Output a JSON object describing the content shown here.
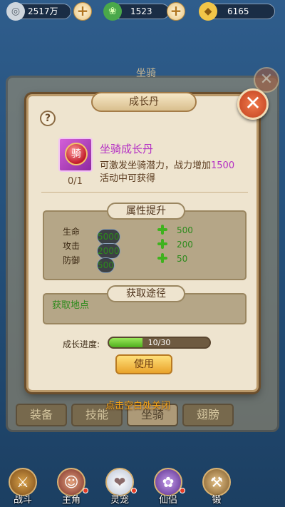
{
  "currency": {
    "silver": {
      "icon": "silver-coin-icon",
      "value": "2517万"
    },
    "jade": {
      "icon": "jade-icon",
      "value": "1523"
    },
    "gold": {
      "icon": "gold-ingot-icon",
      "value": "6165"
    }
  },
  "background_panel": {
    "title": "坐骑",
    "tabs": [
      "装备",
      "技能",
      "坐骑",
      "翅膀"
    ],
    "selected_tab": "坐骑"
  },
  "dialog": {
    "title": "成长丹",
    "help_label": "?",
    "close_label": "✕",
    "item": {
      "icon_char": "骑",
      "count": "0/1",
      "name": "坐骑成长丹",
      "desc_prefix": "可激发坐骑潜力，战力增加",
      "desc_highlight": "1500",
      "desc_line2": "活动中可获得"
    },
    "attributes": {
      "header": "属性提升",
      "rows": [
        {
          "name": "生命",
          "current": "5000",
          "add": "500"
        },
        {
          "name": "攻击",
          "current": "2000",
          "add": "200"
        },
        {
          "name": "防御",
          "current": "500",
          "add": "50"
        }
      ]
    },
    "source": {
      "header": "获取途径",
      "link": "获取地点"
    },
    "progress": {
      "label": "成长进度:",
      "text": "10/30",
      "fraction": 0.333
    },
    "use_button": "使用"
  },
  "hint": "点击空白处关闭",
  "bottom_nav": [
    {
      "label": "战斗",
      "icon": "crossed-swords-icon",
      "badge": false
    },
    {
      "label": "主角",
      "icon": "hero-avatar-icon",
      "badge": true
    },
    {
      "label": "灵宠",
      "icon": "pet-avatar-icon",
      "badge": true
    },
    {
      "label": "仙侣",
      "icon": "companion-avatar-icon",
      "badge": true
    },
    {
      "label": "锻",
      "icon": "forge-icon",
      "badge": false
    }
  ],
  "colors": {
    "accent_purple": "#b42fc4",
    "value_green": "#2d8a1c",
    "hint_orange": "#f0a21a"
  }
}
